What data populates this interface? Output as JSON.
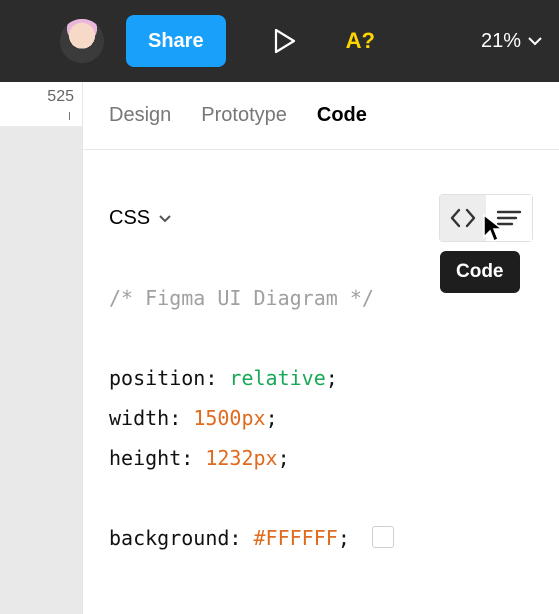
{
  "topbar": {
    "share_label": "Share",
    "help_label": "A?",
    "zoom_label": "21%"
  },
  "ruler": {
    "value": "525"
  },
  "tabs": {
    "design": "Design",
    "prototype": "Prototype",
    "code": "Code"
  },
  "css_selector": {
    "label": "CSS",
    "tooltip": "Code"
  },
  "code": {
    "comment": "/* Figma UI Diagram */",
    "lines": [
      {
        "prop": "position",
        "value": "relative",
        "value_class": "val-green"
      },
      {
        "prop": "width",
        "value": "1500px",
        "value_class": "val-orange"
      },
      {
        "prop": "height",
        "value": "1232px",
        "value_class": "val-orange"
      }
    ],
    "bg_prop": "background",
    "bg_value": "#FFFFFF",
    "bg_swatch": "#FFFFFF"
  }
}
